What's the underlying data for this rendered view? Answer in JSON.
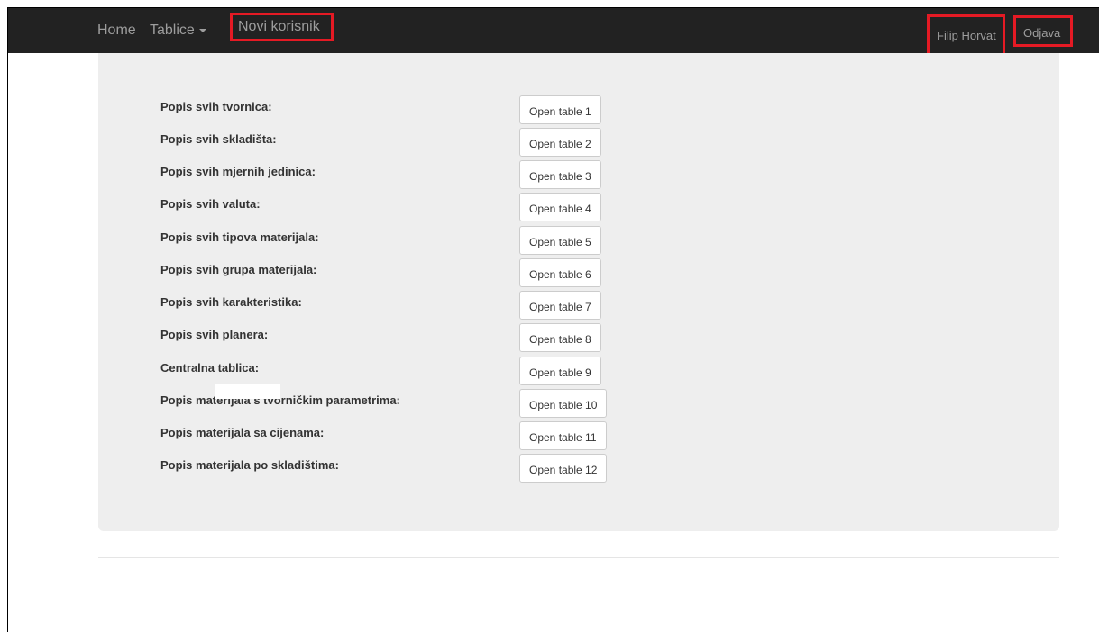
{
  "navbar": {
    "home": "Home",
    "tablice": "Tablice",
    "novi_korisnik": "Novi korisnik",
    "user_name": "Filip Horvat",
    "logout": "Odjava"
  },
  "tables": [
    {
      "label": "Popis svih tvornica:",
      "button": "Open table 1"
    },
    {
      "label": "Popis svih skladišta:",
      "button": "Open table 2"
    },
    {
      "label": "Popis svih mjernih jedinica:",
      "button": "Open table 3"
    },
    {
      "label": "Popis svih valuta:",
      "button": "Open table 4"
    },
    {
      "label": "Popis svih tipova materijala:",
      "button": "Open table 5"
    },
    {
      "label": "Popis svih grupa materijala:",
      "button": "Open table 6"
    },
    {
      "label": "Popis svih karakteristika:",
      "button": "Open table 7"
    },
    {
      "label": "Popis svih planera:",
      "button": "Open table 8"
    },
    {
      "label": "Centralna tablica:",
      "button": "Open table 9"
    },
    {
      "label": "Popis materijala s tvorničkim parametrima:",
      "button": "Open table 10"
    },
    {
      "label": "Popis materijala sa cijenama:",
      "button": "Open table 11"
    },
    {
      "label": "Popis materijala po skladištima:",
      "button": "Open table 12"
    }
  ],
  "colors": {
    "navbar_bg": "#222222",
    "nav_text": "#9d9d9d",
    "highlight": "#e51a24",
    "panel_bg": "#eeeeee"
  }
}
